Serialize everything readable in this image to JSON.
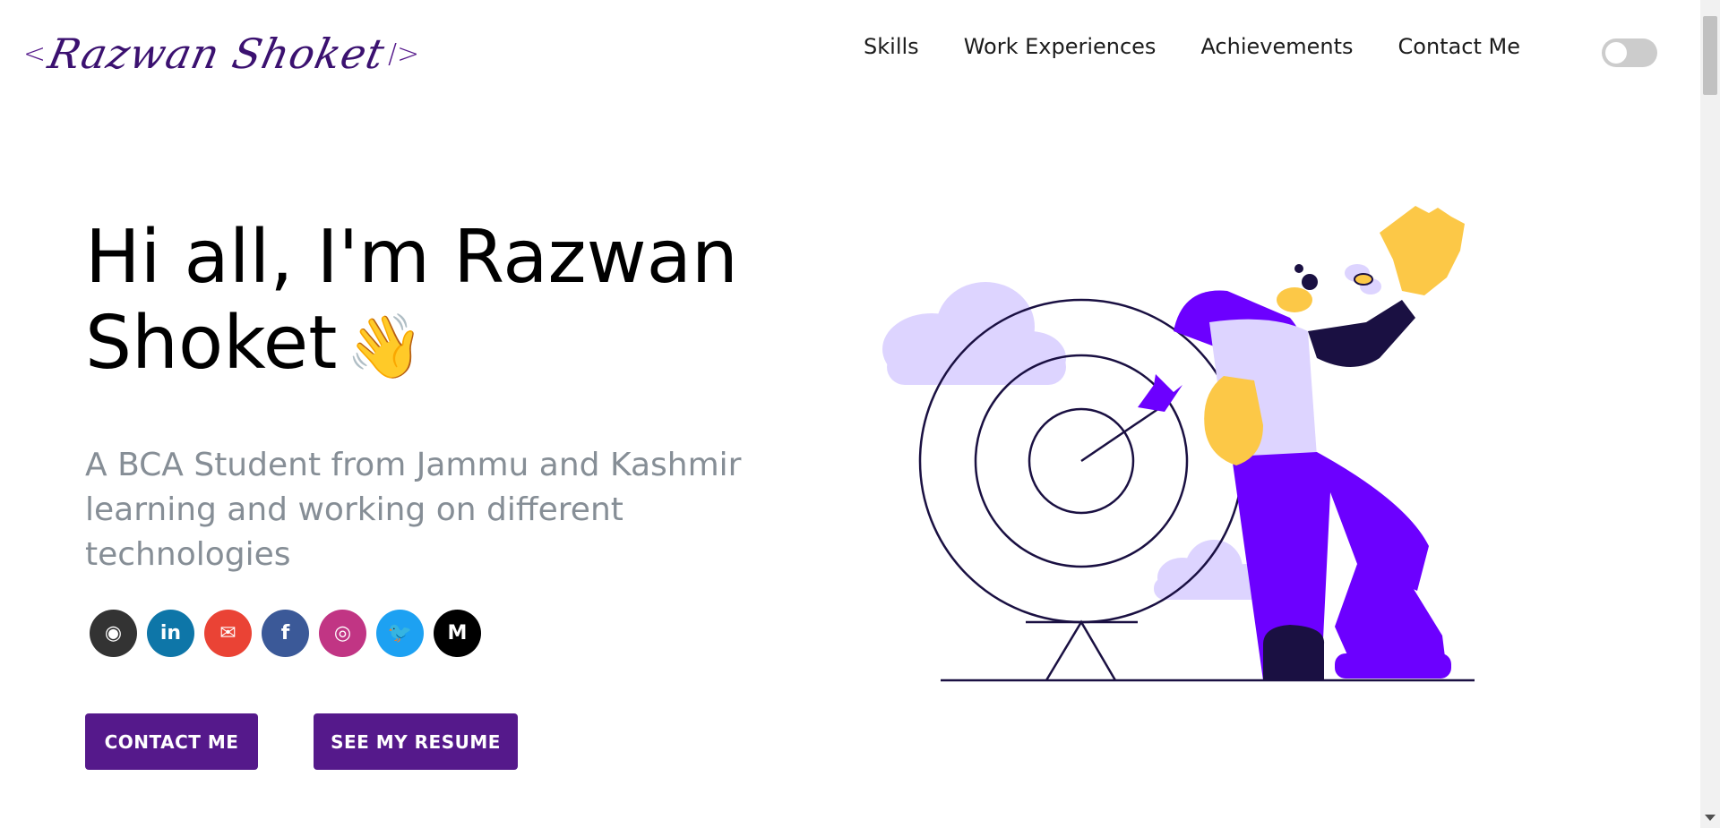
{
  "logo": {
    "open": "<",
    "name": "Razwan Shoket",
    "close": "/>"
  },
  "nav": {
    "items": [
      "Skills",
      "Work Experiences",
      "Achievements",
      "Contact Me"
    ]
  },
  "hero": {
    "greeting": "Hi all, I'm Razwan Shoket",
    "wave_emoji": "👋",
    "subtitle": "A BCA Student from Jammu and Kashmir learning and working on different technologies"
  },
  "social": [
    {
      "icon": "github-icon",
      "glyph": "◉",
      "color": "#333333"
    },
    {
      "icon": "linkedin-icon",
      "glyph": "in",
      "color": "#0e76a8"
    },
    {
      "icon": "email-icon",
      "glyph": "✉",
      "color": "#ea4335"
    },
    {
      "icon": "facebook-icon",
      "glyph": "f",
      "color": "#3b5998"
    },
    {
      "icon": "instagram-icon",
      "glyph": "◎",
      "color": "#c13584"
    },
    {
      "icon": "twitter-icon",
      "glyph": "🐦",
      "color": "#1da1f2"
    },
    {
      "icon": "medium-icon",
      "glyph": "M",
      "color": "#000000"
    }
  ],
  "buttons": {
    "contact": "CONTACT ME",
    "resume": "SEE MY RESUME"
  },
  "colors": {
    "brand": "#55198b",
    "subtitle": "#868e96",
    "accent_purple": "#6c00ff",
    "lavender": "#ddd4ff",
    "yellow": "#fcc847"
  }
}
